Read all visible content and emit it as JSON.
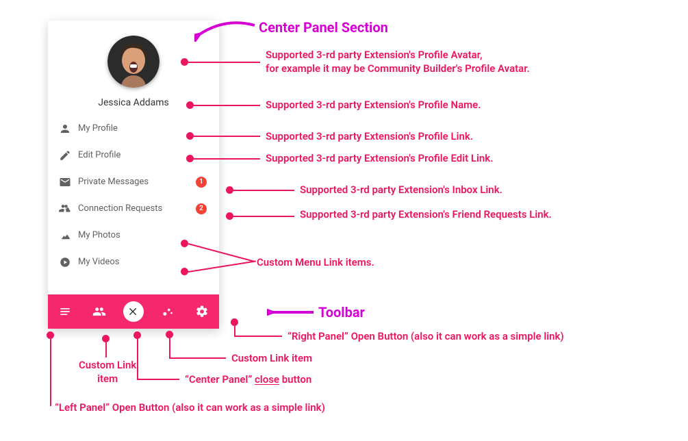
{
  "colors": {
    "pink": "#ec1561",
    "magenta": "#d400d4",
    "toolbar_bg": "#f5286e",
    "badge_bg": "#f44336"
  },
  "profile": {
    "name": "Jessica Addams"
  },
  "menu": [
    {
      "icon": "person",
      "label": "My Profile"
    },
    {
      "icon": "pencil",
      "label": "Edit Profile"
    },
    {
      "icon": "mail",
      "label": "Private Messages",
      "badge": "1"
    },
    {
      "icon": "group-add",
      "label": "Connection Requests",
      "badge": "2"
    },
    {
      "icon": "image",
      "label": "My Photos"
    },
    {
      "icon": "play",
      "label": "My Videos"
    }
  ],
  "toolbar_icons": [
    "left-panel",
    "custom-link-1",
    "center-close",
    "custom-link-2",
    "right-panel"
  ],
  "headings": {
    "center_panel": "Center Panel Section",
    "toolbar": "Toolbar"
  },
  "callouts": {
    "avatar": "Supported 3-rd party Extension's Profile Avatar,\nfor example it may be Community Builder's Profile Avatar.",
    "name": "Supported 3-rd party Extension's Profile Name.",
    "my_profile": "Supported 3-rd party Extension's Profile Link.",
    "edit_profile": "Supported 3-rd party Extension's Profile Edit Link.",
    "inbox": "Supported 3-rd party Extension's Inbox Link.",
    "friends": "Supported 3-rd party Extension's Friend Requests Link.",
    "custom_menu": "Custom Menu Link items.",
    "right_panel": "“Right Panel” Open Button (also it can work as a simple link)",
    "custom_item2": "Custom Link item",
    "center_close_a": "“Center Panel” ",
    "center_close_b": "close",
    "center_close_c": " button",
    "custom_item1": "Custom Link\nitem",
    "left_panel": "“Left Panel” Open Button (also it can work as a simple link)"
  }
}
